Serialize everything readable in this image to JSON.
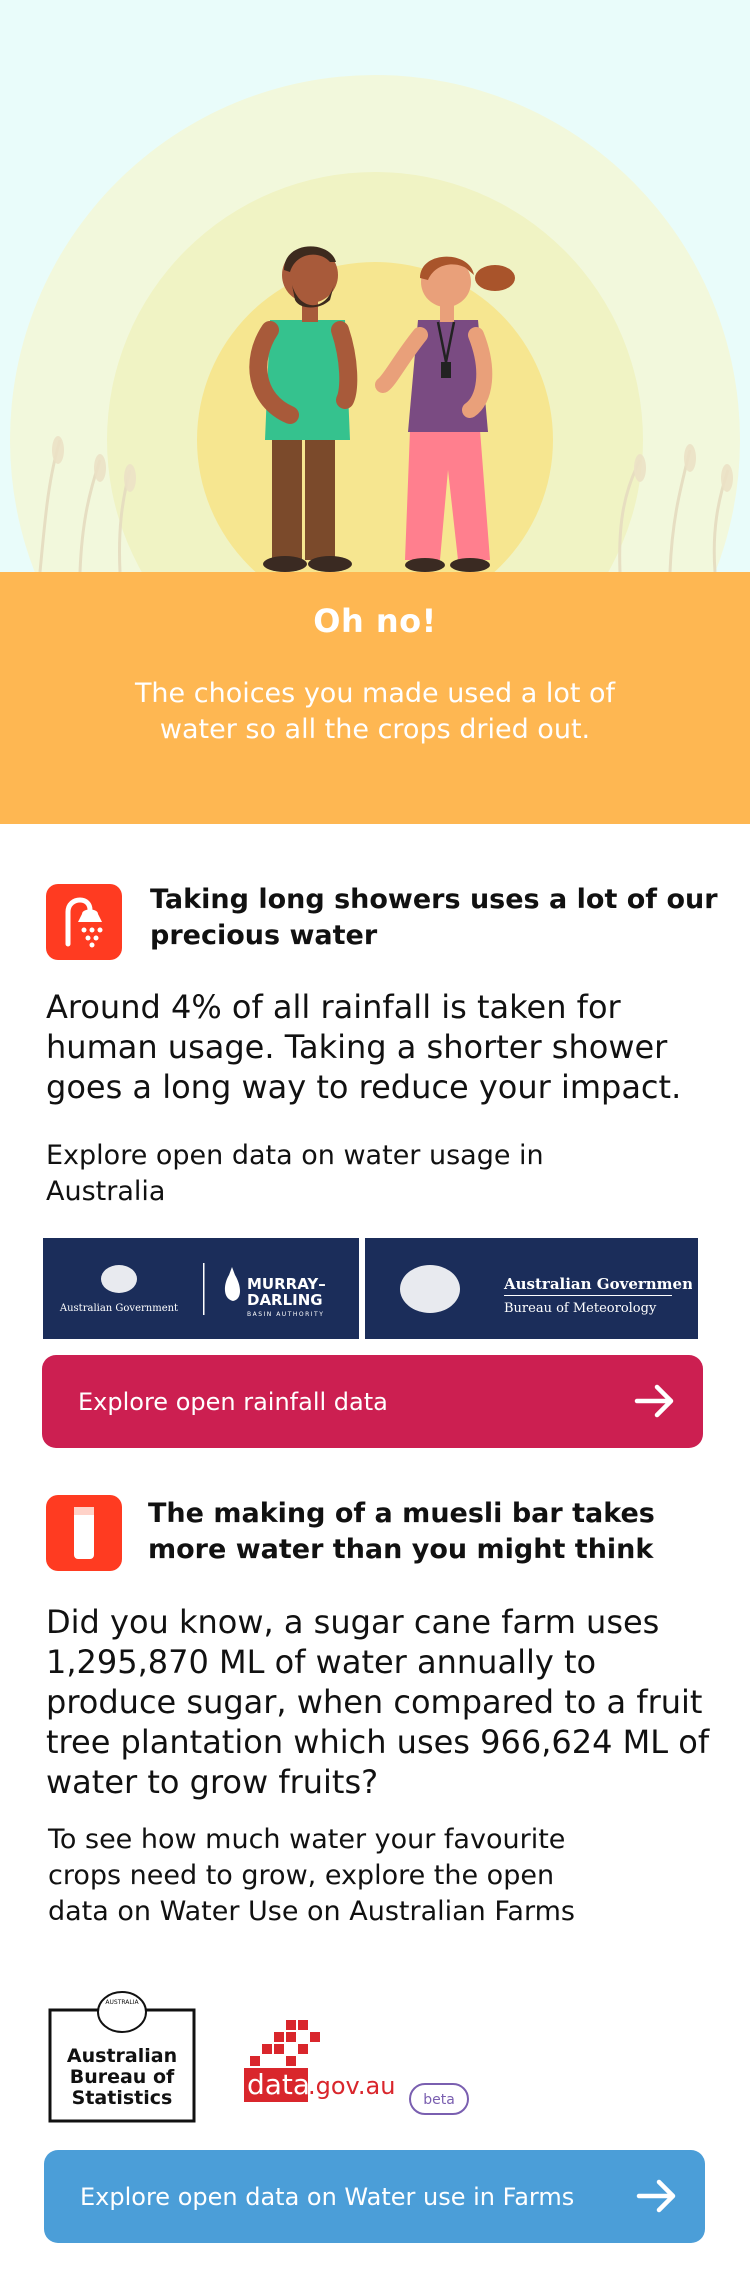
{
  "banner": {
    "title": "Oh no!",
    "message": "The choices you made used a lot of water so all the crops dried out."
  },
  "section1": {
    "icon": "shower-icon",
    "title": "Taking long showers uses a lot of our precious water",
    "body": "Around 4% of all rainfall is taken for human usage. Taking a shorter shower goes a long way to reduce your impact.",
    "explore_text": "Explore open data on water usage in Australia",
    "logos": {
      "mdba_gov": "Australian Government",
      "mdba_name_1": "MURRAY–",
      "mdba_name_2": "DARLING",
      "mdba_sub": "BASIN AUTHORITY",
      "bom_gov": "Australian Government",
      "bom_name": "Bureau of Meteorology"
    },
    "cta": "Explore open rainfall data"
  },
  "section2": {
    "icon": "muesli-bar-icon",
    "title": "The making of a muesli bar takes more water than you might think",
    "body": "Did you know, a sugar cane farm uses 1,295,870 ML of water annually to produce sugar, when compared to a fruit tree plantation which uses 966,624 ML of water to grow fruits?",
    "explore_text": "To see how much water your favourite crops need to grow, explore the open data on Water Use on Australian Farms",
    "logos": {
      "abs_line1": "Australian",
      "abs_line2": "Bureau of",
      "abs_line3": "Statistics",
      "abs_crest": "AUSTRALIA",
      "datagov_main": "data",
      "datagov_domain": ".gov.au",
      "datagov_beta": "beta"
    },
    "cta": "Explore open data on Water use in Farms"
  },
  "colors": {
    "banner": "#feb752",
    "cta_rainfall": "#cc1f51",
    "cta_farms": "#4b9ed8",
    "icon_bg": "#ff3b21",
    "logo_navy": "#1b2d5a"
  }
}
